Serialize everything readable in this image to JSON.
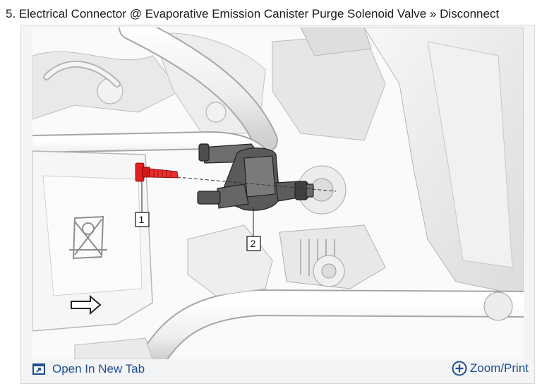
{
  "step": {
    "title": "5. Electrical Connector @ Evaporative Emission Canister Purge Solenoid Valve » Disconnect"
  },
  "figure": {
    "callouts": [
      "1",
      "2"
    ]
  },
  "footer": {
    "open_tab_label": "Open In New Tab",
    "open_tab_icon": "open-in-new-tab-icon",
    "zoom_label": "Zoom/Print",
    "zoom_icon": "zoom-plus-icon"
  },
  "colors": {
    "link": "#1e4e8c",
    "highlight_part": "#e02020",
    "frame_bg": "#f3f4f6"
  }
}
